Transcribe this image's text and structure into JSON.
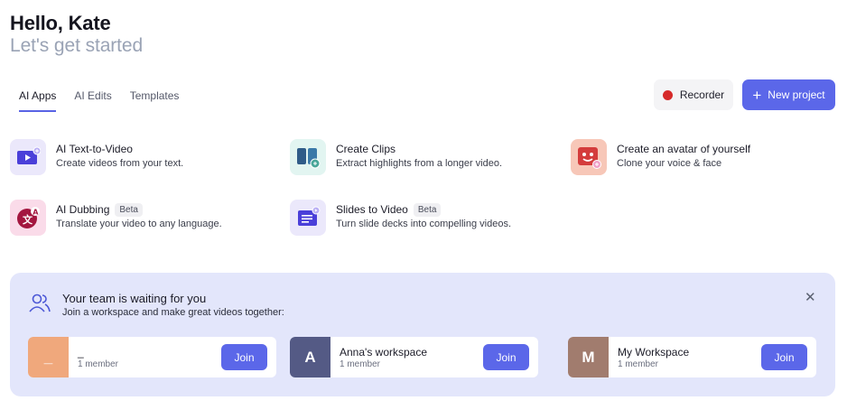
{
  "header": {
    "greeting": "Hello, Kate",
    "subtitle": "Let's get started"
  },
  "tabs": [
    {
      "label": "AI Apps",
      "active": true
    },
    {
      "label": "AI Edits",
      "active": false
    },
    {
      "label": "Templates",
      "active": false
    }
  ],
  "actions": {
    "recorder_label": "Recorder",
    "new_project_label": "New project"
  },
  "apps": [
    {
      "title": "AI Text-to-Video",
      "description": "Create videos from your text.",
      "badge": "",
      "icon": "video-play-icon",
      "icon_bg": "#ebe8fb"
    },
    {
      "title": "Create Clips",
      "description": "Extract highlights from a longer video.",
      "badge": "",
      "icon": "clips-icon",
      "icon_bg": "#e2f5f1"
    },
    {
      "title": "Create an avatar of yourself",
      "description": "Clone your voice & face",
      "badge": "",
      "icon": "avatar-icon",
      "icon_bg": "#f7c7b8"
    },
    {
      "title": "AI Dubbing",
      "description": "Translate your video to any language.",
      "badge": "Beta",
      "icon": "translate-icon",
      "icon_bg": "#fadbe9"
    },
    {
      "title": "Slides to Video",
      "description": "Turn slide decks into compelling videos.",
      "badge": "Beta",
      "icon": "slides-icon",
      "icon_bg": "#ebe8fb"
    }
  ],
  "team": {
    "title": "Your team is waiting for you",
    "subtitle": "Join a workspace and make great videos together:",
    "workspaces": [
      {
        "initial": "_",
        "name": "_",
        "members": "1 member",
        "color": "#f0a87c",
        "join_label": "Join"
      },
      {
        "initial": "A",
        "name": "Anna's workspace",
        "members": "1 member",
        "color": "#545a85",
        "join_label": "Join"
      },
      {
        "initial": "M",
        "name": "My Workspace",
        "members": "1 member",
        "color": "#a17c6e",
        "join_label": "Join"
      }
    ]
  },
  "colors": {
    "accent": "#5b67e9",
    "panel_bg": "#e3e6fb",
    "recorder_dot": "#d62a2a"
  }
}
